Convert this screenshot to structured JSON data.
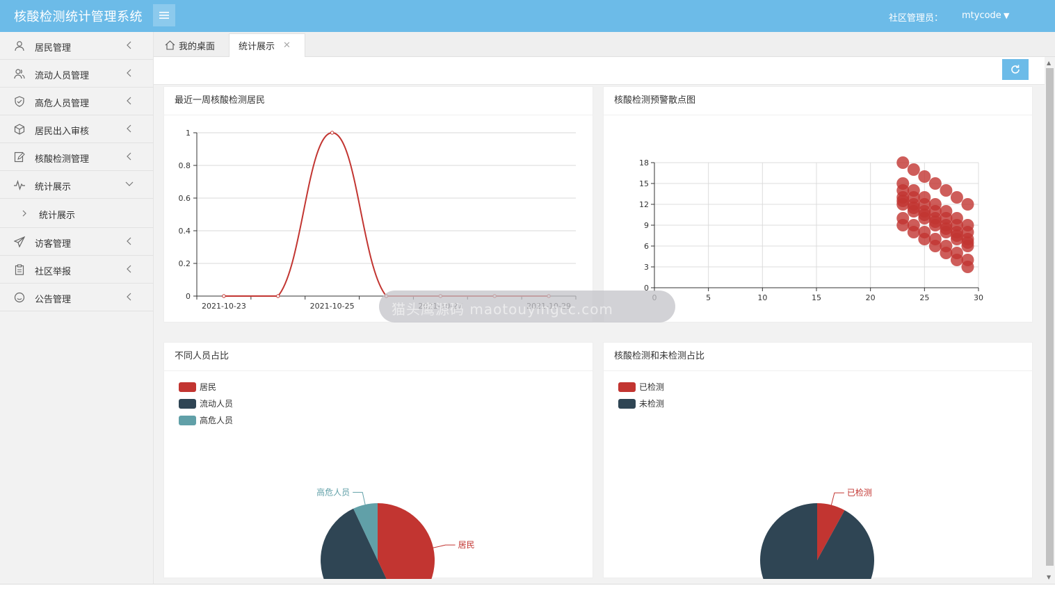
{
  "app": {
    "title": "核酸检测统计管理系统"
  },
  "header": {
    "admin_role": "社区管理员：",
    "admin_user": "mtycode"
  },
  "sidebar": {
    "items": [
      {
        "label": "居民管理",
        "icon": "user-icon"
      },
      {
        "label": "流动人员管理",
        "icon": "users-icon"
      },
      {
        "label": "高危人员管理",
        "icon": "shield-icon"
      },
      {
        "label": "居民出入审核",
        "icon": "cube-icon"
      },
      {
        "label": "核酸检测管理",
        "icon": "edit-icon"
      },
      {
        "label": "统计展示",
        "icon": "pulse-icon",
        "expanded": true
      },
      {
        "label": "访客管理",
        "icon": "send-icon"
      },
      {
        "label": "社区举报",
        "icon": "clipboard-icon"
      },
      {
        "label": "公告管理",
        "icon": "smile-icon"
      }
    ],
    "sub_item": "统计展示"
  },
  "tabs": [
    {
      "label": "我的桌面",
      "icon": "home-icon"
    },
    {
      "label": "统计展示",
      "active": true
    }
  ],
  "watermark": "猫头鹰源码 maotouyingcc.com",
  "panels": {
    "p1": "最近一周核酸检测居民",
    "p2": "核酸检测预警散点图",
    "p3": "不同人员占比",
    "p4": "核酸检测和未检测占比"
  },
  "colors": {
    "accent": "#6cbbe8",
    "red": "#c23531",
    "navy": "#2f4554",
    "teal": "#61a0a8"
  },
  "chart_data": [
    {
      "type": "line",
      "title": "最近一周核酸检测居民",
      "x": [
        "2021-10-23",
        "2021-10-24",
        "2021-10-25",
        "2021-10-26",
        "2021-10-27",
        "2021-10-28",
        "2021-10-29"
      ],
      "x_tick_labels": [
        "2021-10-23",
        "2021-10-25",
        "2021-10-27",
        "2021-10-29"
      ],
      "values": [
        0,
        0,
        1,
        0,
        0,
        0,
        0
      ],
      "ylim": [
        0,
        1
      ],
      "y_ticks": [
        "0",
        "0.2",
        "0.4",
        "0.6",
        "0.8",
        "1"
      ],
      "smooth": true,
      "color": "#c23531"
    },
    {
      "type": "scatter",
      "title": "核酸检测预警散点图",
      "xlim": [
        0,
        30
      ],
      "ylim": [
        0,
        18
      ],
      "x_ticks": [
        "0",
        "5",
        "10",
        "15",
        "20",
        "25",
        "30"
      ],
      "y_ticks": [
        "0",
        "3",
        "6",
        "9",
        "12",
        "15",
        "18"
      ],
      "color": "#c23531",
      "points": [
        [
          23,
          18
        ],
        [
          24,
          17
        ],
        [
          25,
          16
        ],
        [
          26,
          15
        ],
        [
          27,
          14
        ],
        [
          28,
          13
        ],
        [
          29,
          12
        ],
        [
          23,
          15
        ],
        [
          24,
          14
        ],
        [
          25,
          13
        ],
        [
          26,
          12
        ],
        [
          27,
          11
        ],
        [
          28,
          10
        ],
        [
          29,
          9
        ],
        [
          23,
          14
        ],
        [
          24,
          13
        ],
        [
          25,
          12
        ],
        [
          26,
          11
        ],
        [
          27,
          10
        ],
        [
          28,
          9
        ],
        [
          29,
          8
        ],
        [
          23,
          13
        ],
        [
          24,
          12
        ],
        [
          25,
          11
        ],
        [
          26,
          10
        ],
        [
          27,
          9
        ],
        [
          28,
          8
        ],
        [
          29,
          7
        ],
        [
          23,
          12.5
        ],
        [
          24,
          11.5
        ],
        [
          25,
          10.5
        ],
        [
          26,
          9.5
        ],
        [
          27,
          8.5
        ],
        [
          28,
          7.5
        ],
        [
          29,
          6.5
        ],
        [
          23,
          12
        ],
        [
          24,
          11
        ],
        [
          25,
          10
        ],
        [
          26,
          9
        ],
        [
          27,
          8
        ],
        [
          28,
          7
        ],
        [
          29,
          6
        ],
        [
          23,
          10
        ],
        [
          24,
          9
        ],
        [
          25,
          8
        ],
        [
          26,
          7
        ],
        [
          27,
          6
        ],
        [
          28,
          5
        ],
        [
          29,
          4
        ],
        [
          23,
          9
        ],
        [
          24,
          8
        ],
        [
          25,
          7
        ],
        [
          26,
          6
        ],
        [
          27,
          5
        ],
        [
          28,
          4
        ],
        [
          29,
          3
        ]
      ]
    },
    {
      "type": "pie",
      "title": "不同人员占比",
      "series": [
        {
          "name": "居民",
          "value": 43,
          "color": "#c23531"
        },
        {
          "name": "流动人员",
          "value": 50,
          "color": "#2f4554"
        },
        {
          "name": "高危人员",
          "value": 7,
          "color": "#61a0a8"
        }
      ],
      "legend": "top-left"
    },
    {
      "type": "pie",
      "title": "核酸检测和未检测占比",
      "series": [
        {
          "name": "已检测",
          "value": 8,
          "color": "#c23531"
        },
        {
          "name": "未检测",
          "value": 92,
          "color": "#2f4554"
        }
      ],
      "legend": "top-left"
    }
  ]
}
